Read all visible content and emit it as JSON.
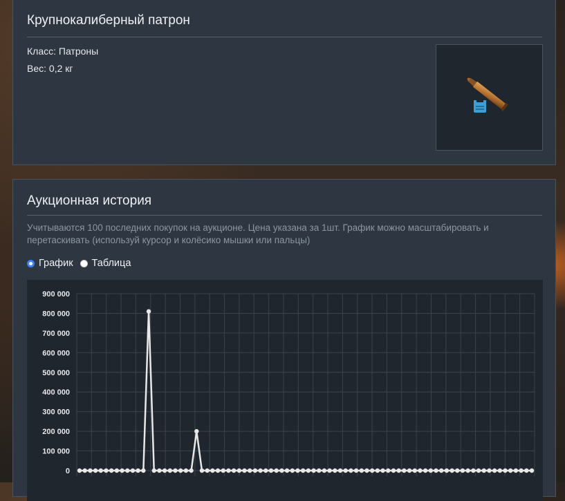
{
  "item": {
    "title": "Крупнокалиберный патрон",
    "class_text": "Класс: Патроны",
    "weight_text": "Вес: 0,2 кг",
    "image_icon": "bullet-cartridge-icon"
  },
  "history": {
    "title": "Аукционная история",
    "note": "Учитываются 100 последних покупок на аукционе. Цена указана за 1шт. График можно масштабировать и перетаскивать (используй курсор и колёсико мышки или пальцы)",
    "view_options": [
      {
        "label": "График",
        "selected": true
      },
      {
        "label": "Таблица",
        "selected": false
      }
    ]
  },
  "colors": {
    "panel_bg": "#2e3741",
    "chart_bg": "#20262d",
    "line": "#e8e8e8",
    "radio_accent": "#3b82f6"
  },
  "chart_data": {
    "type": "line",
    "title": "",
    "xlabel": "",
    "ylabel": "",
    "ylim": [
      0,
      900000
    ],
    "y_ticks": [
      "0",
      "100 000",
      "200 000",
      "300 000",
      "400 000",
      "500 000",
      "600 000",
      "700 000",
      "800 000",
      "900 000"
    ],
    "grid": true,
    "series": [
      {
        "values": [
          0,
          0,
          0,
          0,
          0,
          0,
          0,
          0,
          0,
          0,
          0,
          0,
          0,
          810000,
          0,
          0,
          0,
          0,
          0,
          0,
          0,
          0,
          200000,
          0,
          0,
          0,
          0,
          0,
          0,
          0,
          0,
          0,
          0,
          0,
          0,
          0,
          0,
          0,
          0,
          0,
          0,
          0,
          0,
          0,
          0,
          0,
          0,
          0,
          0,
          0,
          0,
          0,
          0,
          0,
          0,
          0,
          0,
          0,
          0,
          0,
          0,
          0,
          0,
          0,
          0,
          0,
          0,
          0,
          0,
          0,
          0,
          0,
          0,
          0,
          0,
          0,
          0,
          0,
          0,
          0,
          0,
          0,
          0,
          0,
          0,
          0
        ]
      }
    ]
  }
}
